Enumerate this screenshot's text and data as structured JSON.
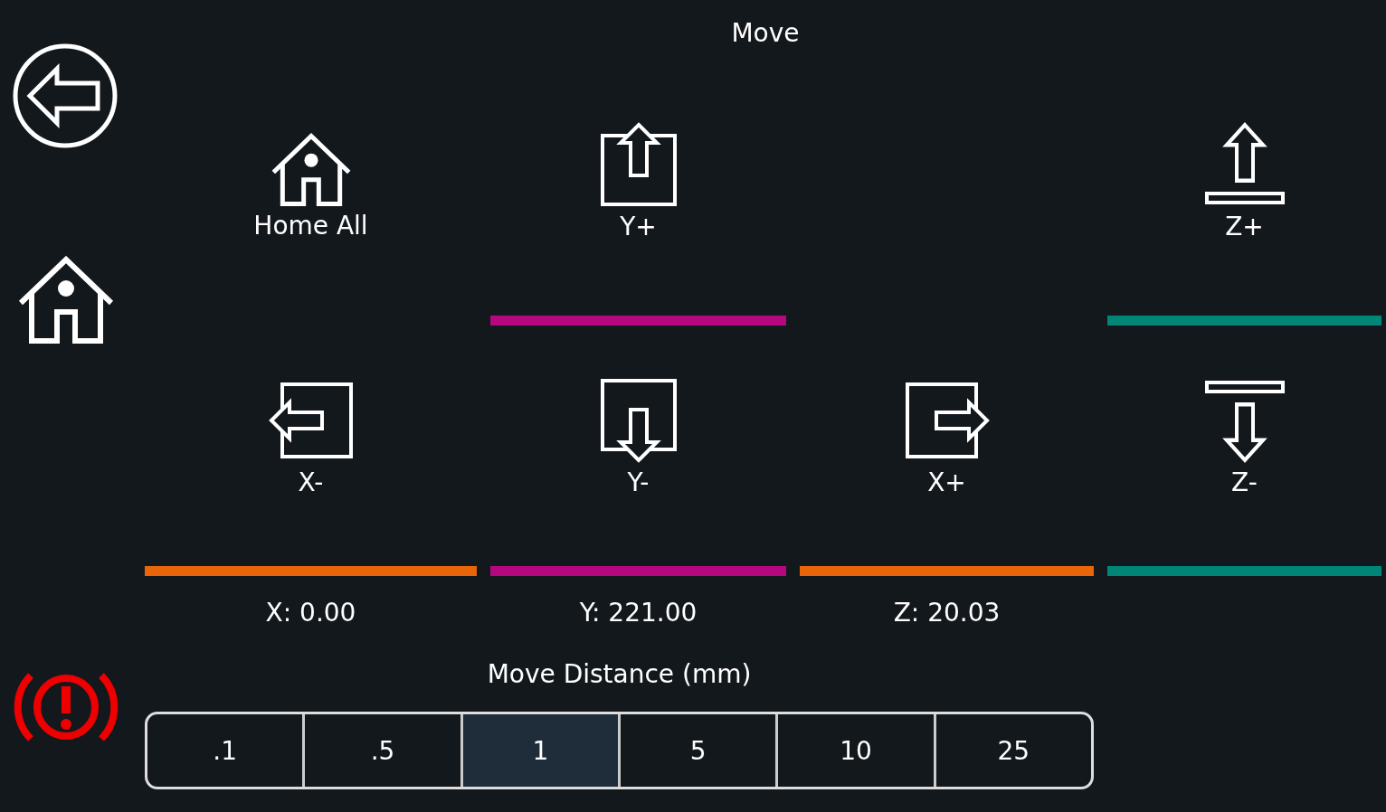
{
  "title": "Move",
  "controls": [
    [
      {
        "kind": "home",
        "label": "Home All"
      },
      {
        "kind": "x_left",
        "label": "X-",
        "color": "#e8650a"
      }
    ],
    [
      {
        "kind": "y_up",
        "label": "Y+",
        "color": "#b5087f"
      },
      {
        "kind": "y_down",
        "label": "Y-",
        "color": "#b5087f"
      }
    ],
    [
      {
        "kind": "x_right",
        "label": "X+",
        "color": "#e8650a"
      }
    ],
    [
      {
        "kind": "z_up",
        "label": "Z+",
        "color": "#008577"
      },
      {
        "kind": "z_down",
        "label": "Z-",
        "color": "#008577"
      }
    ]
  ],
  "positions": [
    "X: 0.00",
    "Y: 221.00",
    "Z: 20.03"
  ],
  "distance": {
    "label": "Move Distance (mm)",
    "options": [
      {
        "label": ".1",
        "selected": false
      },
      {
        "label": ".5",
        "selected": false
      },
      {
        "label": "1",
        "selected": true
      },
      {
        "label": "5",
        "selected": false
      },
      {
        "label": "10",
        "selected": false
      },
      {
        "label": "25",
        "selected": false
      }
    ]
  }
}
